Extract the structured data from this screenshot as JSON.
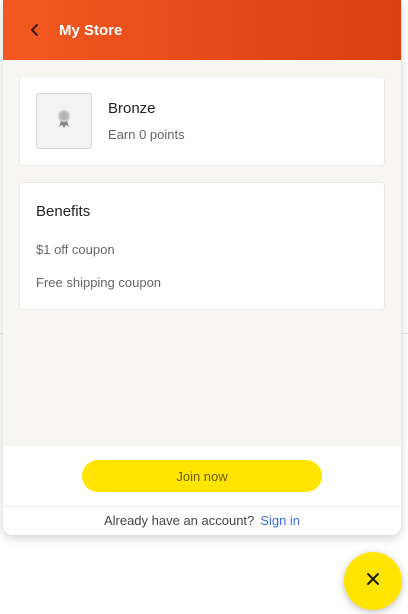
{
  "header": {
    "title": "My Store",
    "back_icon": "chevron-left-icon"
  },
  "tier": {
    "name": "Bronze",
    "points_text": "Earn 0 points",
    "badge_icon": "award-ribbon-icon"
  },
  "benefits": {
    "title": "Benefits",
    "items": [
      "$1 off coupon",
      "Free shipping coupon"
    ]
  },
  "footer": {
    "join_label": "Join now",
    "account_prompt": "Already have an account?",
    "signin_label": "Sign in"
  },
  "fab": {
    "icon": "close-icon"
  },
  "colors": {
    "header_start": "#f2591f",
    "header_end": "#d9400f",
    "accent_yellow": "#ffe500",
    "link_blue": "#3d6ee0"
  }
}
